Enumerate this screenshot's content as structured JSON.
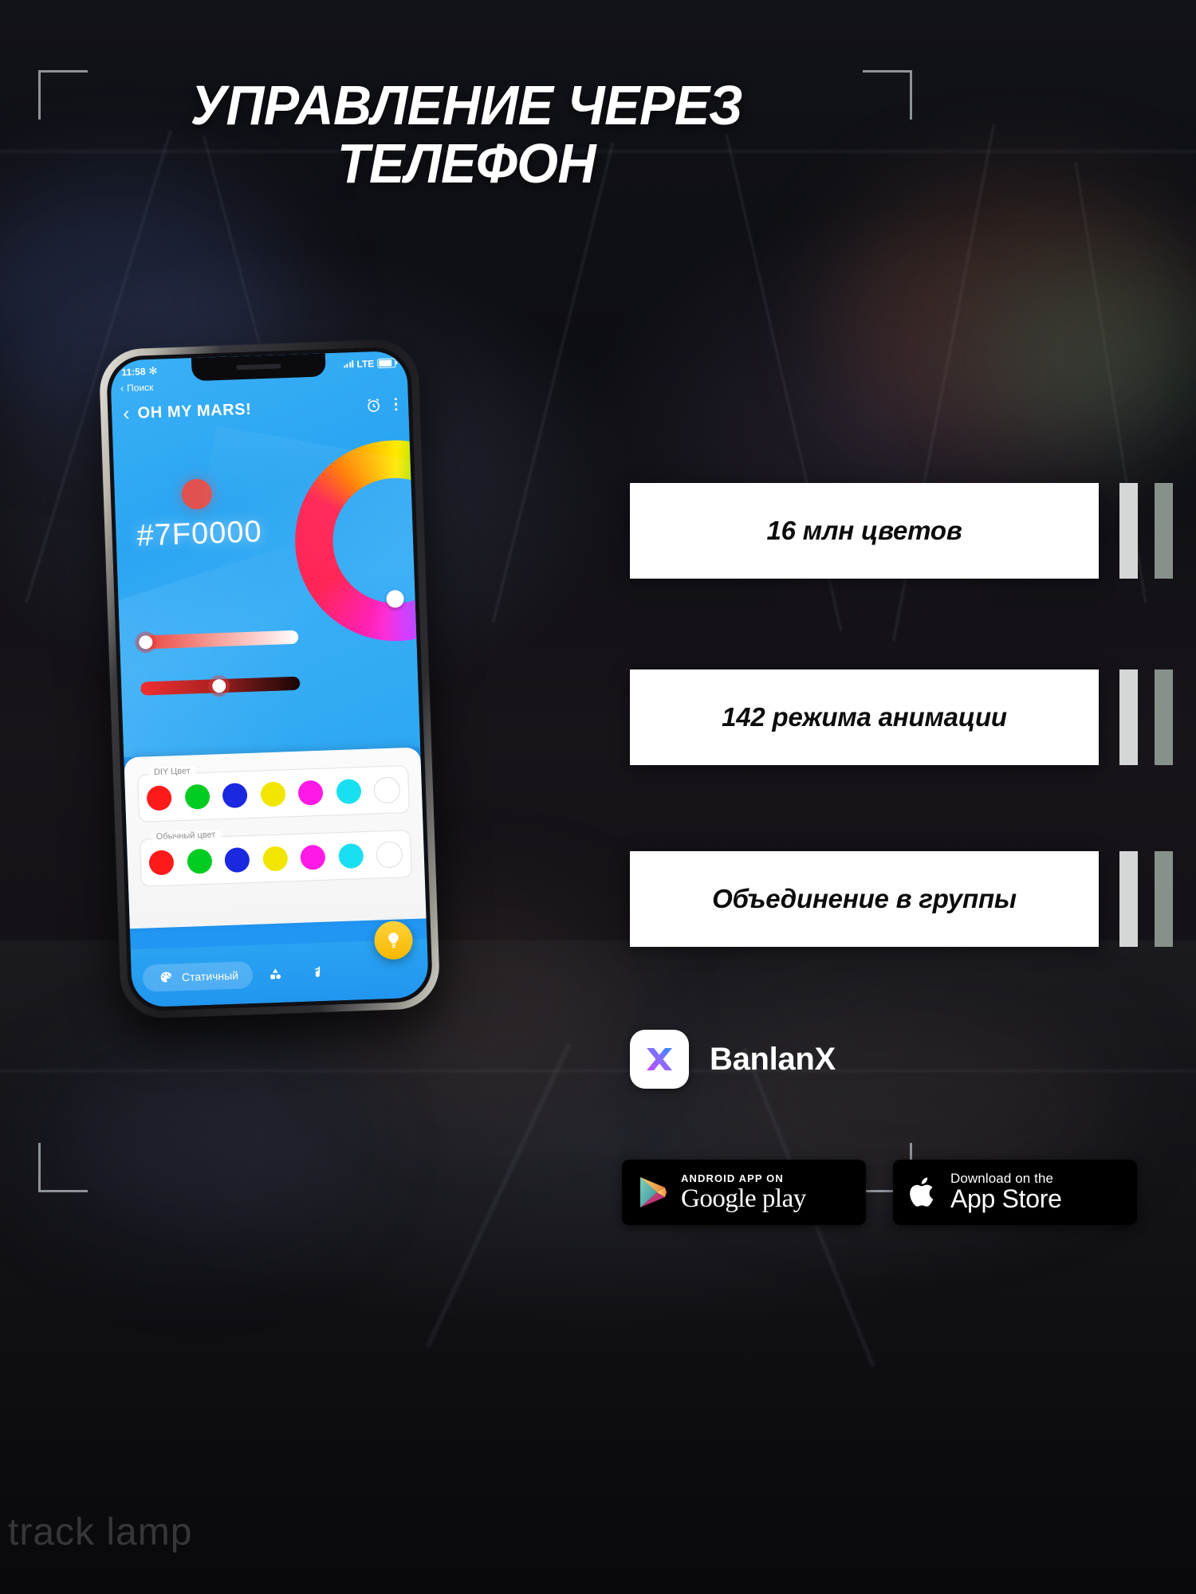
{
  "headline": {
    "line1": "УПРАВЛЕНИЕ ЧЕРЕЗ",
    "line2": "ТЕЛЕФОН"
  },
  "features": [
    {
      "label": "16 млн цветов"
    },
    {
      "label": "142 режима анимации"
    },
    {
      "label": "Объединение в группы"
    }
  ],
  "brand": {
    "name": "BanlanX",
    "mark_icon": "banlanx-x-logo",
    "gradient_from": "#b24bff",
    "gradient_to": "#2f8fff"
  },
  "badges": {
    "google_play": {
      "top": "ANDROID APP ON",
      "main": "Google play",
      "icon": "google-play-triangle-icon"
    },
    "app_store": {
      "top": "Download on the",
      "main": "App Store",
      "icon": "apple-logo-icon"
    }
  },
  "watermark": "track lamp",
  "accent": {
    "bar_light": "#d4d7d5",
    "bar_dark": "#86918a",
    "app_blue": "#2aa5f2",
    "bracket": "#8e9299"
  },
  "phone": {
    "status_bar": {
      "time": "11:58",
      "bluetooth_icon": "asterisk-icon",
      "carrier_label": "Поиск",
      "signal_icon": "signal-bars-icon",
      "network": "LTE",
      "battery_icon": "battery-icon"
    },
    "app_header": {
      "back_icon": "chevron-left-icon",
      "title": "OH MY MARS!",
      "alarm_icon": "alarm-clock-icon",
      "menu_icon": "three-dots-vertical-icon"
    },
    "canvas": {
      "preview_swatch": "preview-color-dot",
      "hex_value": "#7F0000",
      "color_wheel_icon": "color-wheel-ring",
      "wheel_thumb_icon": "wheel-handle"
    },
    "sliders": [
      {
        "name": "saturation",
        "from": "#e8403c",
        "to": "#ffffff",
        "thumb_pct": 0
      },
      {
        "name": "brightness",
        "from": "#f02f30",
        "to": "#1a0606",
        "thumb_pct": 45
      }
    ],
    "palettes": [
      {
        "legend": "DIY Цвет",
        "colors": [
          "#ff1a1a",
          "#00cc22",
          "#1a28e0",
          "#f2e600",
          "#ff19e6",
          "#19e0f0",
          "#ffffff"
        ]
      },
      {
        "legend": "Обычный цвет",
        "colors": [
          "#ff1a1a",
          "#00cc22",
          "#1a28e0",
          "#f2e600",
          "#ff19e6",
          "#19e0f0",
          "#ffffff"
        ]
      }
    ],
    "tabbar": {
      "active_label": "Статичный",
      "active_icon": "palette-icon",
      "tab2_icon": "shapes-icon",
      "tab3_icon": "music-note-icon",
      "fab_icon": "lightbulb-icon"
    }
  }
}
